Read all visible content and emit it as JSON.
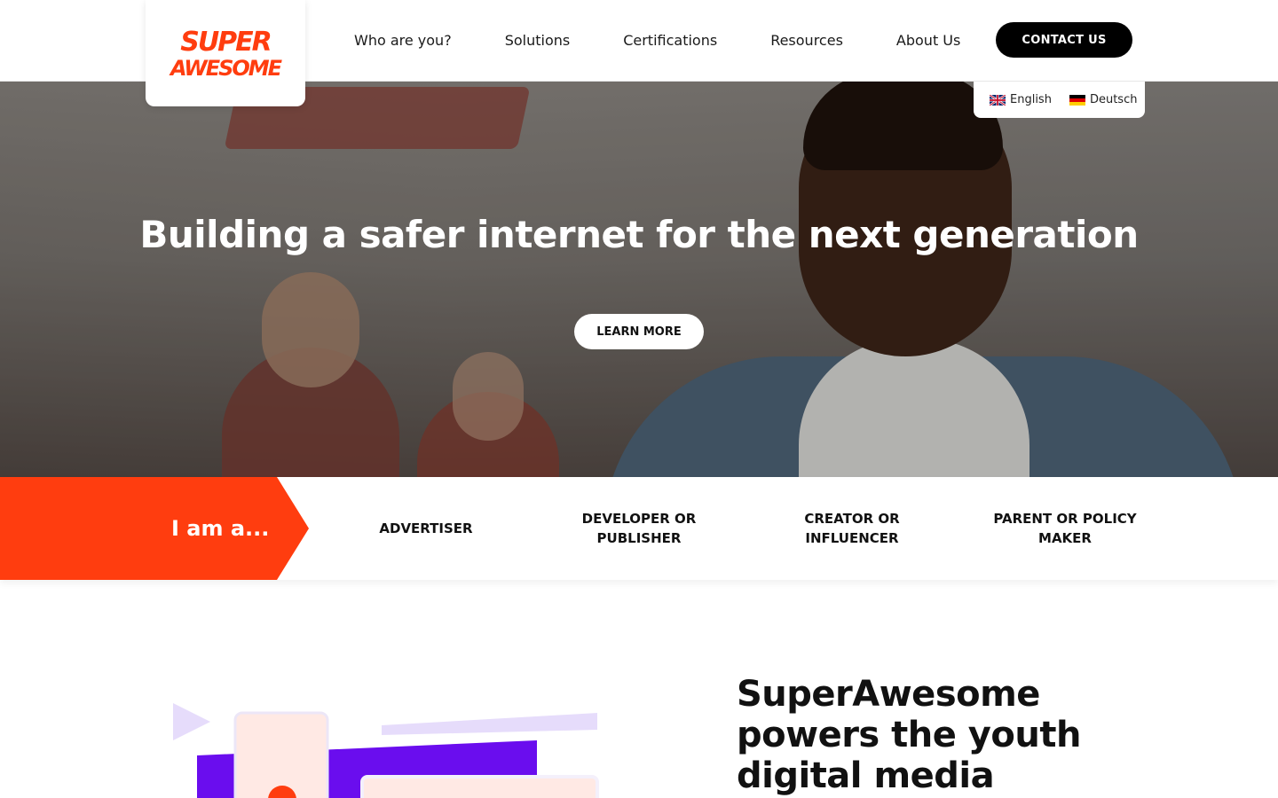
{
  "brand": {
    "logo_line1": "SUPER",
    "logo_line2": "AWESOME",
    "logo_color": "#ff3d0f"
  },
  "nav": {
    "items": [
      {
        "label": "Who are you?"
      },
      {
        "label": "Solutions"
      },
      {
        "label": "Certifications"
      },
      {
        "label": "Resources"
      },
      {
        "label": "About Us"
      }
    ],
    "contact_label": "CONTACT US"
  },
  "languages": [
    {
      "label": "English",
      "flag": "uk-flag-icon"
    },
    {
      "label": "Deutsch",
      "flag": "germany-flag-icon"
    }
  ],
  "hero": {
    "title": "Building a safer internet for the next generation",
    "cta_label": "LEARN MORE"
  },
  "iam": {
    "label": "I am a...",
    "options": [
      {
        "label": "ADVERTISER"
      },
      {
        "label": "DEVELOPER OR PUBLISHER"
      },
      {
        "label": "CREATOR OR INFLUENCER"
      },
      {
        "label": "PARENT OR POLICY MAKER"
      }
    ],
    "accent": "#ff3d0f"
  },
  "section": {
    "title": "SuperAwesome powers the youth digital media"
  },
  "colors": {
    "accent": "#ff3d0f",
    "purple": "#6a0dee",
    "lavender": "#e6dcfb",
    "black": "#000000"
  }
}
